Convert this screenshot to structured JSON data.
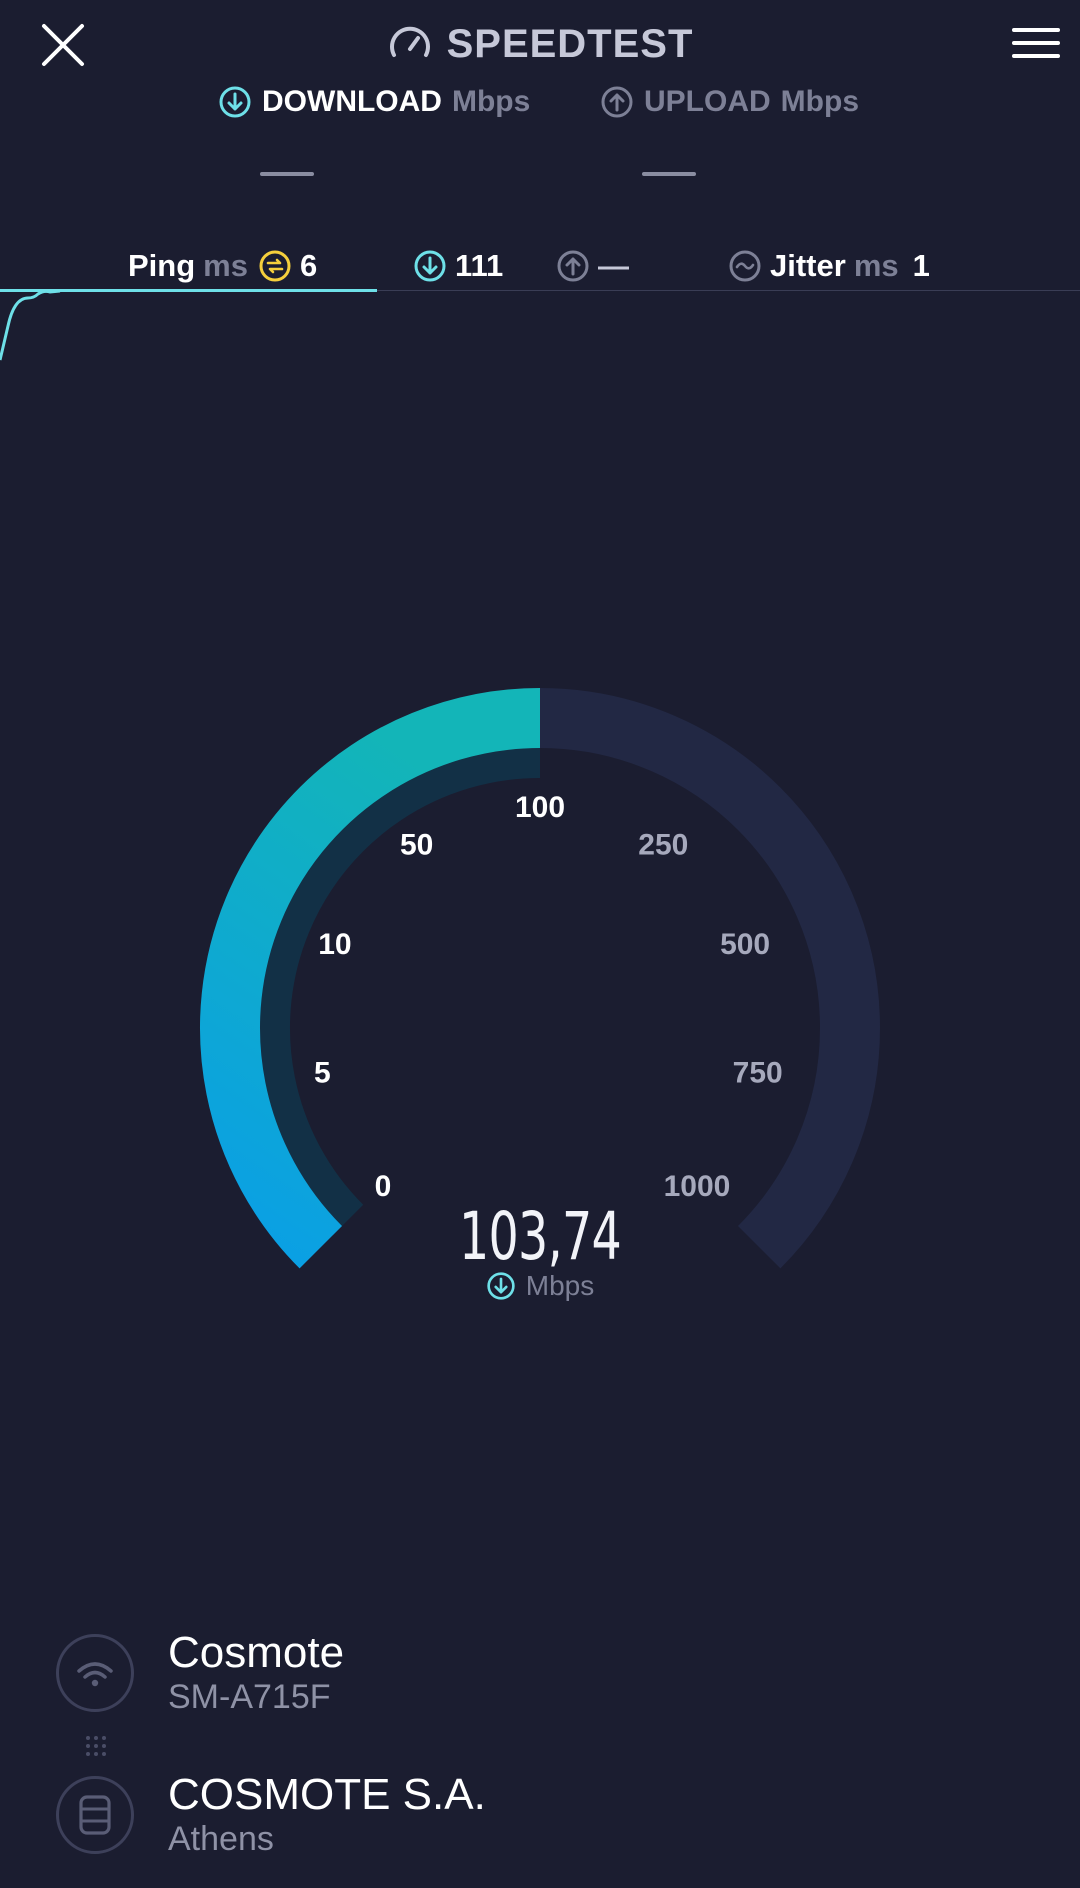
{
  "header": {
    "brand": "SPEEDTEST"
  },
  "download": {
    "label": "DOWNLOAD",
    "unit": "Mbps",
    "value": "—"
  },
  "upload": {
    "label": "UPLOAD",
    "unit": "Mbps",
    "value": "—"
  },
  "stats": {
    "ping_label": "Ping",
    "ping_unit": "ms",
    "ping_value": "6",
    "download_value": "111",
    "upload_value": "—",
    "jitter_label": "Jitter",
    "jitter_unit": "ms",
    "jitter_value": "1"
  },
  "gauge": {
    "scale_labels": [
      "0",
      "5",
      "10",
      "50",
      "100",
      "250",
      "500",
      "750",
      "1000"
    ],
    "current_value": "103,74",
    "unit": "Mbps",
    "fill_fraction": 0.5
  },
  "connection": {
    "provider": "Cosmote",
    "device": "SM-A715F",
    "server_name": "COSMOTE S.A.",
    "server_location": "Athens"
  },
  "colors": {
    "background": "#1b1d30",
    "accent_cyan": "#6ee0e8",
    "gauge_teal": "#13b5b8",
    "gauge_blue": "#0a9fe6",
    "gauge_track": "#222844",
    "ping_yellow": "#f5cf3c"
  }
}
